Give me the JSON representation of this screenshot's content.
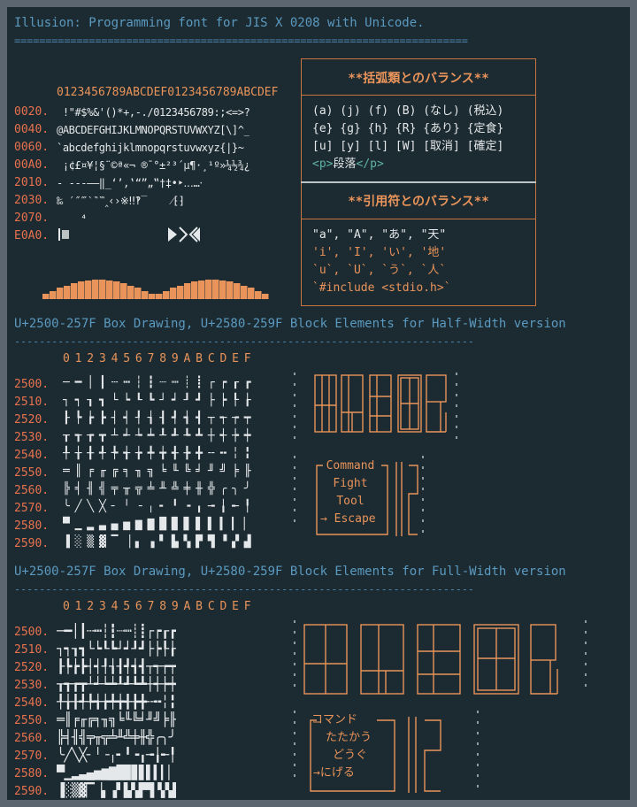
{
  "title": "Illusion: Programming font for JIS X 0208 with Unicode.",
  "rule_double": "=========================================================================",
  "rule_dash": "--------------------------------------------------------------------------",
  "hex_header": "0123456789ABCDEF0123456789ABCDEF",
  "char_rows": [
    {
      "code": "0020.",
      "chars": " !\"#$%&'()*+,-./0123456789:;<=>?"
    },
    {
      "code": "0040.",
      "chars": "@ABCDEFGHIJKLMNOPQRSTUVWXYZ[\\]^_"
    },
    {
      "code": "0060.",
      "chars": "`abcdefghijklmnopqrstuvwxyz{|}~"
    },
    {
      "code": "00A0.",
      "chars": " ¡¢£¤¥¦§¨©ª«¬ ®¯°±²³´µ¶·¸¹º»¼½¾¿"
    },
    {
      "code": "2010.",
      "chars": "- ---–—‖_‘’‚‛“”„‟†‡•‣․‥…‧"
    },
    {
      "code": "2030.",
      "chars": "‰ ′″‴‵‶‷‸‹›※‼‽‾    ⁄⁅⁆"
    },
    {
      "code": "2070.",
      "chars": "    ⁴"
    },
    {
      "code": "E0A0.",
      "chars": ""
    }
  ],
  "bracket_panel": {
    "title": "**括弧類とのバランス**",
    "lines": [
      "(a) (j) (f) (B) (なし) (税込)",
      "{e} {g} {h} {R} {あり} {定食}",
      "[u] [y] [l] [W] [取消] [確定]"
    ],
    "tag_open": "<p>",
    "tag_text": "段落",
    "tag_close": "</p>"
  },
  "quote_panel": {
    "title": "**引用符とのバランス**",
    "lines": [
      "\"a\", \"A\", \"あ\", \"天\"",
      "'i', 'I', 'い', '地'",
      "`u`, `U`, `う`, `人`",
      "`#include <stdio.h>`"
    ]
  },
  "section_half": "U+2500-257F Box Drawing, U+2580-259F Block Elements for Half-Width version",
  "section_full": "U+2500-257F Box Drawing, U+2580-259F Block Elements for Full-Width version",
  "col_header": "0 1 2 3 4 5 6 7 8 9 A B C D E F",
  "box_rows": [
    "2500.",
    "2510.",
    "2520.",
    "2530.",
    "2540.",
    "2550.",
    "2560.",
    "2570.",
    "2580.",
    "2590."
  ],
  "half_box_glyphs": [
    "─ ━ │ ┃ ┄ ┅ ┆ ┇ ┈ ┉ ┊ ┋ ┌ ┍ ┎ ┏",
    "┐ ┑ ┒ ┓ └ ┕ ┖ ┗ ┘ ┙ ┚ ┛ ├ ┝ ┞ ┟",
    "┠ ┡ ┢ ┣ ┤ ┥ ┦ ┧ ┨ ┩ ┪ ┫ ┬ ┭ ┮ ┯",
    "┰ ┱ ┲ ┳ ┴ ┵ ┶ ┷ ┸ ┹ ┺ ┻ ┼ ┽ ┾ ┿",
    "╀ ╁ ╂ ╃ ╄ ╅ ╆ ╇ ╈ ╉ ╊ ╋ ╌ ╍ ╎ ╏",
    "═ ║ ╒ ╓ ╔ ╕ ╖ ╗ ╘ ╙ ╚ ╛ ╜ ╝ ╞ ╟",
    "╠ ╡ ╢ ╣ ╤ ╥ ╦ ╧ ╨ ╩ ╪ ╫ ╬ ╭ ╮ ╯",
    "╰ ╱ ╲ ╳ ╴ ╵ ╶ ╷ ╸ ╹ ╺ ╻ ╼ ╽ ╾ ╿",
    "▀ ▁ ▂ ▃ ▄ ▅ ▆ ▇ █ ▉ ▊ ▋ ▌ ▍ ▎ ▏",
    "▐ ░ ▒ ▓ ▔ ▕ ▖ ▗ ▘ ▙ ▚ ▛ ▜ ▝ ▞ ▟"
  ],
  "full_box_glyphs": [
    "─━│┃┄┅┆┇┈┉┊┋┌┍┎┏",
    "┐┑┒┓└┕┖┗┘┙┚┛├┝┞┟",
    "┠┡┢┣┤┥┦┧┨┩┪┫┬┭┮┯",
    "┰┱┲┳┴┵┶┷┸┹┺┻┼┽┾┿",
    "╀╁╂╃╄╅╆╇╈╉╊╋╌╍╎╏",
    "═║╒╓╔╕╖╗╘╙╚╛╜╝╞╟",
    "╠╡╢╣╤╥╦╧╨╩╪╫╬╭╮╯",
    "╰╱╲╳╴╵╶╷╸╹╺╻╼╽╾╿",
    "▀▁▂▃▄▅▆▇█▉▊▋▌▍▎▏",
    "▐░▒▓▔▕▖▗▘▙▚▛▜▝▞▟"
  ],
  "half_menu": [
    "Command",
    "Fight",
    "Tool",
    "→ Escape"
  ],
  "full_menu": [
    "コマンド",
    "たたかう",
    "どうぐ",
    "→にげる"
  ],
  "colors": {
    "bg": "#1c2a31",
    "frame": "#5b6670",
    "accent": "#e9945a",
    "code": "#e8724d",
    "text": "#e4e8ea",
    "heading": "#5b9ac0"
  }
}
